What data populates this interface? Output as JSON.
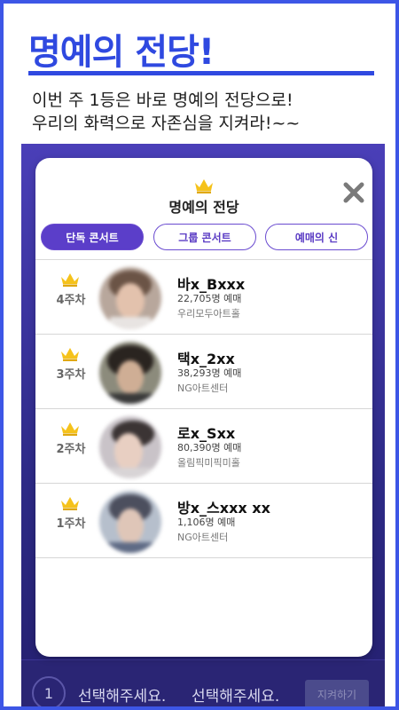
{
  "headline": "명예의 전당!",
  "subtitle": {
    "line1": "이번 주 1등은 바로 명예의 전당으로!",
    "line2": "우리의 화력으로 자존심을 지켜라!~~"
  },
  "modal": {
    "title": "명예의 전당",
    "close_icon": "close-x-icon",
    "crown_icon": "crown-icon",
    "tabs": [
      {
        "label": "단독 콘서트",
        "active": true
      },
      {
        "label": "그룹 콘서트",
        "active": false
      },
      {
        "label": "예매의 신",
        "active": false
      }
    ],
    "rows": [
      {
        "week": "4주차",
        "name": "바x_Bxxx",
        "count": "22,705명 예매",
        "venue": "우리모두아트홀"
      },
      {
        "week": "3주차",
        "name": "택x_2xx",
        "count": "38,293명 예매",
        "venue": "NG아트센터"
      },
      {
        "week": "2주차",
        "name": "로x_Sxx",
        "count": "80,390명 예매",
        "venue": "올림픽미픽미홀"
      },
      {
        "week": "1주차",
        "name": "방x_스xxx xx",
        "count": "1,106명 예매",
        "venue": "NG아트센터"
      }
    ]
  },
  "bottom_bar": {
    "select1": "선택해주세요.",
    "select2": "선택해주세요.",
    "button": "지켜하기",
    "circle": "1"
  },
  "colors": {
    "brand": "#2f49e0",
    "accent": "#5b3ec9",
    "crown": "#f5c21b"
  }
}
